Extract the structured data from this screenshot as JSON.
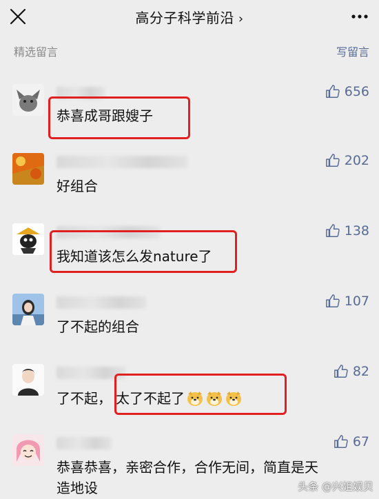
{
  "header": {
    "title": "高分子科学前沿",
    "chevron": "›"
  },
  "section": {
    "left_label": "精选留言",
    "right_label": "写留言"
  },
  "comments": [
    {
      "likes": "656",
      "text": "恭喜成哥跟嫂子"
    },
    {
      "likes": "202",
      "text": "好组合"
    },
    {
      "likes": "138",
      "text": "我知道该怎么发nature了"
    },
    {
      "likes": "107",
      "text": "了不起的组合"
    },
    {
      "likes": "82",
      "text_a": "了不起，",
      "text_b": "太了不起了"
    },
    {
      "likes": "67",
      "line1": "恭喜恭喜，亲密合作，合作无间，简直是天",
      "line2": "造地设"
    }
  ],
  "watermark": "头条 @兴姐娱贝",
  "colors": {
    "link": "#576b95",
    "highlight": "#e02020",
    "background": "#ededed"
  }
}
